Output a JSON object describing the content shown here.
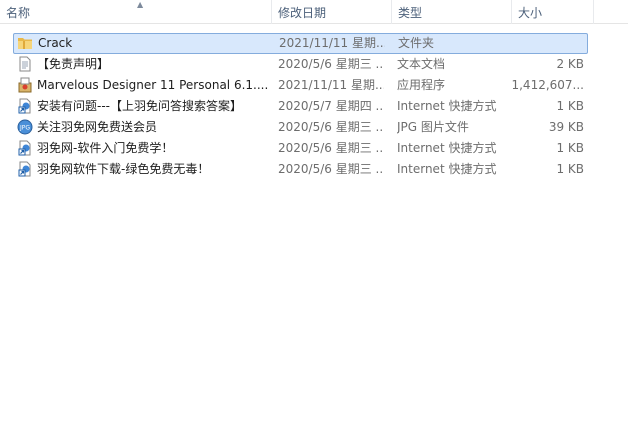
{
  "columns": {
    "name": "名称",
    "date": "修改日期",
    "type": "类型",
    "size": "大小"
  },
  "files": [
    {
      "icon": "folder-icon",
      "name": "Crack",
      "date": "2021/11/11 星期...",
      "type": "文件夹",
      "size": "",
      "selected": true
    },
    {
      "icon": "text-document-icon",
      "name": "【免责声明】",
      "date": "2020/5/6 星期三 ...",
      "type": "文本文档",
      "size": "2 KB",
      "selected": false
    },
    {
      "icon": "installer-icon",
      "name": "Marvelous Designer 11 Personal 6.1....",
      "date": "2021/11/11 星期...",
      "type": "应用程序",
      "size": "1,412,607...",
      "selected": false
    },
    {
      "icon": "internet-shortcut-icon",
      "name": "安装有问题---【上羽免问答搜索答案】",
      "date": "2020/5/7 星期四 ...",
      "type": "Internet 快捷方式",
      "size": "1 KB",
      "selected": false
    },
    {
      "icon": "jpg-image-icon",
      "name": "关注羽免网免费送会员",
      "date": "2020/5/6 星期三 ...",
      "type": "JPG 图片文件",
      "size": "39 KB",
      "selected": false
    },
    {
      "icon": "internet-shortcut-icon",
      "name": "羽免网-软件入门免费学！",
      "date": "2020/5/6 星期三 ...",
      "type": "Internet 快捷方式",
      "size": "1 KB",
      "selected": false
    },
    {
      "icon": "internet-shortcut-icon",
      "name": "羽免网软件下载-绿色免费无毒！",
      "date": "2020/5/6 星期三 ...",
      "type": "Internet 快捷方式",
      "size": "1 KB",
      "selected": false
    }
  ]
}
